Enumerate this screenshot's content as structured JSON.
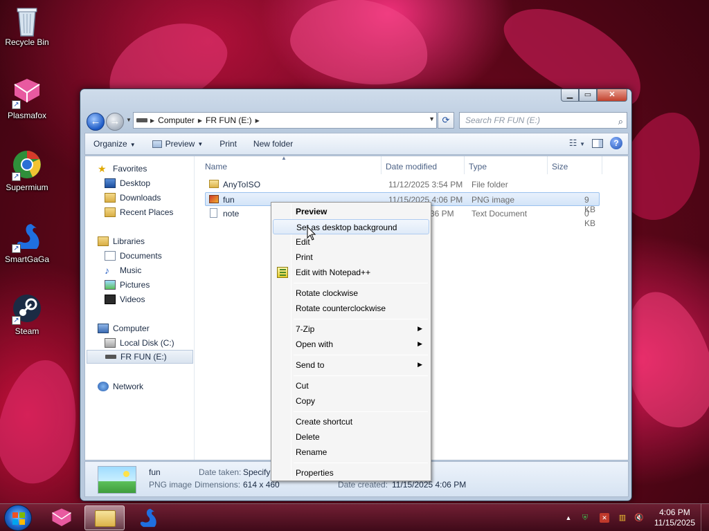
{
  "desktop": {
    "icons": [
      {
        "label": "Recycle Bin"
      },
      {
        "label": "Plasmafox"
      },
      {
        "label": "Supermium"
      },
      {
        "label": "SmartGaGa"
      },
      {
        "label": "Steam"
      }
    ]
  },
  "window": {
    "address": {
      "segments": [
        "Computer",
        "FR FUN (E:)"
      ]
    },
    "search": {
      "placeholder": "Search FR FUN (E:)"
    },
    "toolbar": {
      "organize": "Organize",
      "preview": "Preview",
      "print": "Print",
      "new_folder": "New folder"
    },
    "nav": {
      "favorites": "Favorites",
      "desktop": "Desktop",
      "downloads": "Downloads",
      "recent_places": "Recent Places",
      "libraries": "Libraries",
      "documents": "Documents",
      "music": "Music",
      "pictures": "Pictures",
      "videos": "Videos",
      "computer": "Computer",
      "local_disk": "Local Disk (C:)",
      "fr_fun": "FR FUN (E:)",
      "network": "Network"
    },
    "columns": {
      "name": "Name",
      "date": "Date modified",
      "type": "Type",
      "size": "Size"
    },
    "files": [
      {
        "name": "AnyToISO",
        "date": "11/12/2025 3:54 PM",
        "type": "File folder",
        "size": ""
      },
      {
        "name": "fun",
        "date": "11/15/2025 4:06 PM",
        "type": "PNG image",
        "size": "9 KB"
      },
      {
        "name": "note",
        "date": "36 PM",
        "type": "Text Document",
        "size": "0 KB"
      }
    ],
    "details": {
      "name": "fun",
      "kind": "PNG image",
      "date_taken_label": "Date taken:",
      "date_taken_value": "Specify",
      "dimensions_label": "Dimensions:",
      "dimensions_value": "614 x 460",
      "date_created_label": "Date created:",
      "date_created_value": "11/15/2025 4:06 PM"
    }
  },
  "context_menu": {
    "preview": "Preview",
    "set_bg": "Set as desktop background",
    "edit": "Edit",
    "print": "Print",
    "edit_npp": "Edit with Notepad++",
    "rotate_cw": "Rotate clockwise",
    "rotate_ccw": "Rotate counterclockwise",
    "seven_zip": "7-Zip",
    "open_with": "Open with",
    "send_to": "Send to",
    "cut": "Cut",
    "copy": "Copy",
    "create_shortcut": "Create shortcut",
    "delete": "Delete",
    "rename": "Rename",
    "properties": "Properties"
  },
  "taskbar": {
    "time": "4:06 PM",
    "date": "11/15/2025"
  },
  "colors": {
    "accent": "#1e5bc6",
    "selection": "#d3e4f8",
    "taskbar": "#5a1428"
  }
}
